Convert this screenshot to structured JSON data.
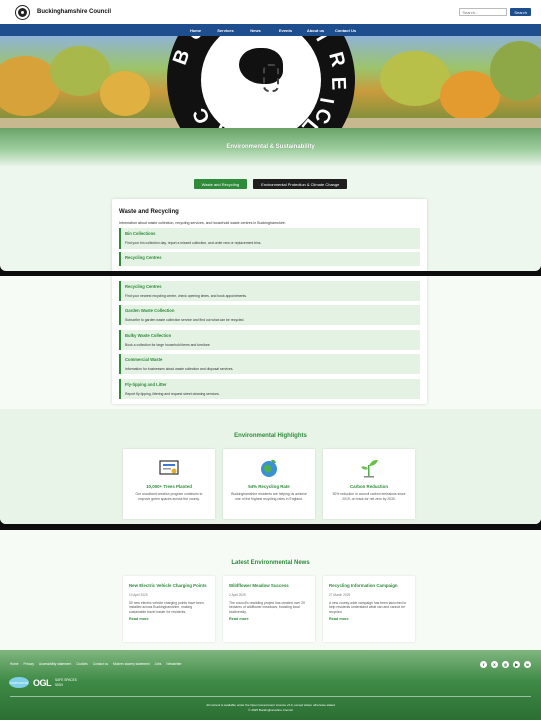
{
  "header": {
    "site_name": "Buckinghamshire Council",
    "search_placeholder": "Search...",
    "search_button": "Search"
  },
  "nav": [
    "Home",
    "Services",
    "News",
    "Events",
    "About us",
    "Contact Us"
  ],
  "hero": {
    "seal_letters": [
      "B",
      "U",
      "C",
      "I",
      "R",
      "E",
      "C",
      "O",
      "C",
      "I",
      "L"
    ],
    "title": "Environmental & Sustainability"
  },
  "tabs": [
    "Waste and Recycling",
    "Environmental Protection & Climate Change"
  ],
  "waste": {
    "heading": "Waste and Recycling",
    "intro": "Information about waste collection, recycling services, and household waste centres in Buckinghamshire.",
    "items": [
      {
        "title": "Bin Collections",
        "desc": "Find your bin collection day, report a missed collection, and order new or replacement bins."
      },
      {
        "title": "Recycling Centres",
        "desc": ""
      },
      {
        "title": "Recycling Centres",
        "desc": "Find your nearest recycling centre, check opening times, and book appointments."
      },
      {
        "title": "Garden Waste Collection",
        "desc": "Subscribe to garden waste collection service and find out what can be recycled."
      },
      {
        "title": "Bulky Waste Collection",
        "desc": "Book a collection for large household items and furniture."
      },
      {
        "title": "Commercial Waste",
        "desc": "Information for businesses about waste collection and disposal services."
      },
      {
        "title": "Fly-tipping and Litter",
        "desc": "Report fly-tipping, littering and request street cleaning services."
      }
    ]
  },
  "highlights": {
    "title": "Environmental Highlights",
    "cards": [
      {
        "icon": "tree-certificate-icon",
        "title": "10,000+ Trees Planted",
        "desc": "Our woodland creation program continues to improve green spaces across the county."
      },
      {
        "icon": "globe-recycle-icon",
        "title": "54% Recycling Rate",
        "desc": "Buckinghamshire residents are helping us achieve one of the highest recycling rates in England."
      },
      {
        "icon": "sprout-icon",
        "title": "Carbon Reduction",
        "desc": "30% reduction in council carbon emissions since 2019, on track for net zero by 2030."
      }
    ]
  },
  "news": {
    "title": "Latest Environmental News",
    "cards": [
      {
        "title": "New Electric Vehicle Charging Points",
        "date": "10 April 2025",
        "desc": "50 new electric vehicle charging points have been installed across Buckinghamshire, making sustainable travel easier for residents.",
        "link": "Read more"
      },
      {
        "title": "Wildflower Meadow Success",
        "date": "2 April 2025",
        "desc": "The council's rewilding project has created over 20 hectares of wildflower meadows, boosting local biodiversity.",
        "link": "Read more"
      },
      {
        "title": "Recycling Information Campaign",
        "date": "27 March 2025",
        "desc": "A new county-wide campaign has been launched to help residents understand what can and cannot be recycled.",
        "link": "Read more"
      }
    ]
  },
  "footer": {
    "links": [
      "Home",
      "Privacy",
      "Accessibility statement",
      "Cookies",
      "Contact us",
      "Modern slavery statement",
      "Jobs",
      "Newsletter"
    ],
    "social": [
      "f",
      "X",
      "◎",
      "▶",
      "in"
    ],
    "partner_oval": "CORPORATE",
    "ogl": "OGL",
    "sd_line1": "SAFE SPACES",
    "sd_line2": "SIGN",
    "licence": "All content is available under the Open Government Licence v3.0, except where otherwise stated",
    "copyright": "© 2025 Buckinghamshire Council"
  }
}
